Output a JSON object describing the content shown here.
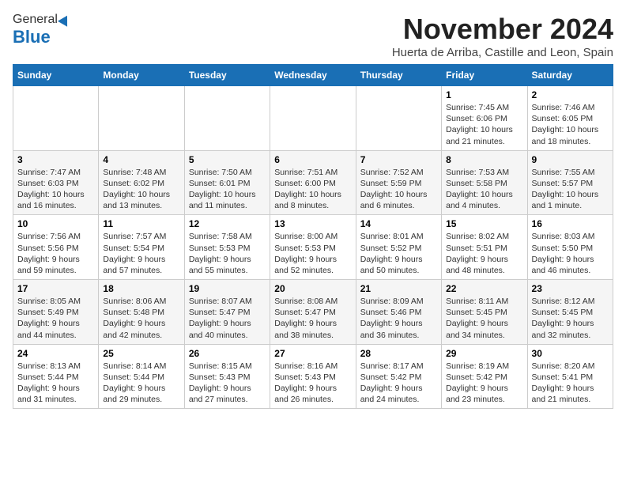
{
  "header": {
    "logo_general": "General",
    "logo_blue": "Blue",
    "month_title": "November 2024",
    "subtitle": "Huerta de Arriba, Castille and Leon, Spain"
  },
  "weekdays": [
    "Sunday",
    "Monday",
    "Tuesday",
    "Wednesday",
    "Thursday",
    "Friday",
    "Saturday"
  ],
  "weeks": [
    [
      {
        "day": "",
        "info": ""
      },
      {
        "day": "",
        "info": ""
      },
      {
        "day": "",
        "info": ""
      },
      {
        "day": "",
        "info": ""
      },
      {
        "day": "",
        "info": ""
      },
      {
        "day": "1",
        "info": "Sunrise: 7:45 AM\nSunset: 6:06 PM\nDaylight: 10 hours and 21 minutes."
      },
      {
        "day": "2",
        "info": "Sunrise: 7:46 AM\nSunset: 6:05 PM\nDaylight: 10 hours and 18 minutes."
      }
    ],
    [
      {
        "day": "3",
        "info": "Sunrise: 7:47 AM\nSunset: 6:03 PM\nDaylight: 10 hours and 16 minutes."
      },
      {
        "day": "4",
        "info": "Sunrise: 7:48 AM\nSunset: 6:02 PM\nDaylight: 10 hours and 13 minutes."
      },
      {
        "day": "5",
        "info": "Sunrise: 7:50 AM\nSunset: 6:01 PM\nDaylight: 10 hours and 11 minutes."
      },
      {
        "day": "6",
        "info": "Sunrise: 7:51 AM\nSunset: 6:00 PM\nDaylight: 10 hours and 8 minutes."
      },
      {
        "day": "7",
        "info": "Sunrise: 7:52 AM\nSunset: 5:59 PM\nDaylight: 10 hours and 6 minutes."
      },
      {
        "day": "8",
        "info": "Sunrise: 7:53 AM\nSunset: 5:58 PM\nDaylight: 10 hours and 4 minutes."
      },
      {
        "day": "9",
        "info": "Sunrise: 7:55 AM\nSunset: 5:57 PM\nDaylight: 10 hours and 1 minute."
      }
    ],
    [
      {
        "day": "10",
        "info": "Sunrise: 7:56 AM\nSunset: 5:56 PM\nDaylight: 9 hours and 59 minutes."
      },
      {
        "day": "11",
        "info": "Sunrise: 7:57 AM\nSunset: 5:54 PM\nDaylight: 9 hours and 57 minutes."
      },
      {
        "day": "12",
        "info": "Sunrise: 7:58 AM\nSunset: 5:53 PM\nDaylight: 9 hours and 55 minutes."
      },
      {
        "day": "13",
        "info": "Sunrise: 8:00 AM\nSunset: 5:53 PM\nDaylight: 9 hours and 52 minutes."
      },
      {
        "day": "14",
        "info": "Sunrise: 8:01 AM\nSunset: 5:52 PM\nDaylight: 9 hours and 50 minutes."
      },
      {
        "day": "15",
        "info": "Sunrise: 8:02 AM\nSunset: 5:51 PM\nDaylight: 9 hours and 48 minutes."
      },
      {
        "day": "16",
        "info": "Sunrise: 8:03 AM\nSunset: 5:50 PM\nDaylight: 9 hours and 46 minutes."
      }
    ],
    [
      {
        "day": "17",
        "info": "Sunrise: 8:05 AM\nSunset: 5:49 PM\nDaylight: 9 hours and 44 minutes."
      },
      {
        "day": "18",
        "info": "Sunrise: 8:06 AM\nSunset: 5:48 PM\nDaylight: 9 hours and 42 minutes."
      },
      {
        "day": "19",
        "info": "Sunrise: 8:07 AM\nSunset: 5:47 PM\nDaylight: 9 hours and 40 minutes."
      },
      {
        "day": "20",
        "info": "Sunrise: 8:08 AM\nSunset: 5:47 PM\nDaylight: 9 hours and 38 minutes."
      },
      {
        "day": "21",
        "info": "Sunrise: 8:09 AM\nSunset: 5:46 PM\nDaylight: 9 hours and 36 minutes."
      },
      {
        "day": "22",
        "info": "Sunrise: 8:11 AM\nSunset: 5:45 PM\nDaylight: 9 hours and 34 minutes."
      },
      {
        "day": "23",
        "info": "Sunrise: 8:12 AM\nSunset: 5:45 PM\nDaylight: 9 hours and 32 minutes."
      }
    ],
    [
      {
        "day": "24",
        "info": "Sunrise: 8:13 AM\nSunset: 5:44 PM\nDaylight: 9 hours and 31 minutes."
      },
      {
        "day": "25",
        "info": "Sunrise: 8:14 AM\nSunset: 5:44 PM\nDaylight: 9 hours and 29 minutes."
      },
      {
        "day": "26",
        "info": "Sunrise: 8:15 AM\nSunset: 5:43 PM\nDaylight: 9 hours and 27 minutes."
      },
      {
        "day": "27",
        "info": "Sunrise: 8:16 AM\nSunset: 5:43 PM\nDaylight: 9 hours and 26 minutes."
      },
      {
        "day": "28",
        "info": "Sunrise: 8:17 AM\nSunset: 5:42 PM\nDaylight: 9 hours and 24 minutes."
      },
      {
        "day": "29",
        "info": "Sunrise: 8:19 AM\nSunset: 5:42 PM\nDaylight: 9 hours and 23 minutes."
      },
      {
        "day": "30",
        "info": "Sunrise: 8:20 AM\nSunset: 5:41 PM\nDaylight: 9 hours and 21 minutes."
      }
    ]
  ]
}
